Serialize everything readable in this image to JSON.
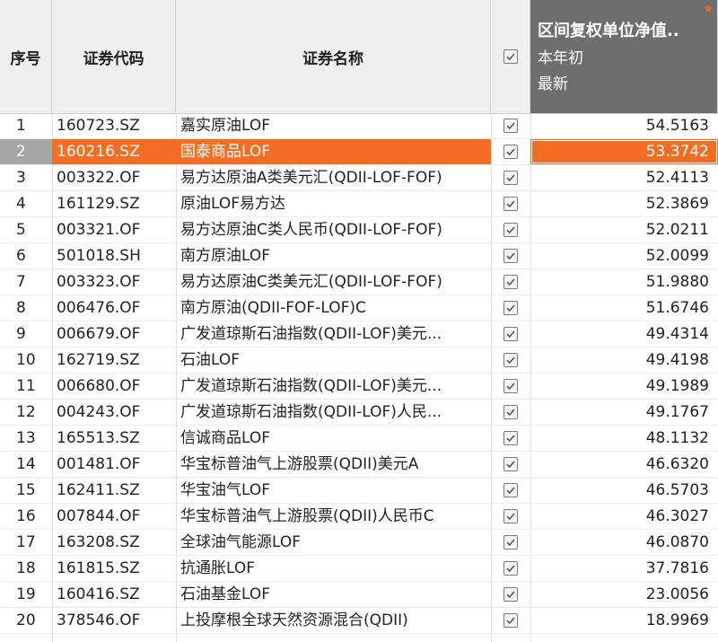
{
  "header": {
    "seq": "序号",
    "code": "证券代码",
    "name": "证券名称",
    "value_title": "区间复权单位净值..",
    "value_sub1": "本年初",
    "value_sub2": "最新",
    "star": "★",
    "check_icon": "checkbox-checked-icon"
  },
  "colors": {
    "selected_row": "#f36d22",
    "header_value_bg": "#6e6e6e",
    "star": "#f36d22"
  },
  "selected_index": 1,
  "rows": [
    {
      "seq": "1",
      "code": "160723.SZ",
      "name": "嘉实原油LOF",
      "value": "54.5163"
    },
    {
      "seq": "2",
      "code": "160216.SZ",
      "name": "国泰商品LOF",
      "value": "53.3742"
    },
    {
      "seq": "3",
      "code": "003322.OF",
      "name": "易方达原油A类美元汇(QDII-LOF-FOF)",
      "value": "52.4113"
    },
    {
      "seq": "4",
      "code": "161129.SZ",
      "name": "原油LOF易方达",
      "value": "52.3869"
    },
    {
      "seq": "5",
      "code": "003321.OF",
      "name": "易方达原油C类人民币(QDII-LOF-FOF)",
      "value": "52.0211"
    },
    {
      "seq": "6",
      "code": "501018.SH",
      "name": "南方原油LOF",
      "value": "52.0099"
    },
    {
      "seq": "7",
      "code": "003323.OF",
      "name": "易方达原油C类美元汇(QDII-LOF-FOF)",
      "value": "51.9880"
    },
    {
      "seq": "8",
      "code": "006476.OF",
      "name": "南方原油(QDII-FOF-LOF)C",
      "value": "51.6746"
    },
    {
      "seq": "9",
      "code": "006679.OF",
      "name": "广发道琼斯石油指数(QDII-LOF)美元...",
      "value": "49.4314"
    },
    {
      "seq": "10",
      "code": "162719.SZ",
      "name": "石油LOF",
      "value": "49.4198"
    },
    {
      "seq": "11",
      "code": "006680.OF",
      "name": "广发道琼斯石油指数(QDII-LOF)美元...",
      "value": "49.1989"
    },
    {
      "seq": "12",
      "code": "004243.OF",
      "name": "广发道琼斯石油指数(QDII-LOF)人民...",
      "value": "49.1767"
    },
    {
      "seq": "13",
      "code": "165513.SZ",
      "name": "信诚商品LOF",
      "value": "48.1132"
    },
    {
      "seq": "14",
      "code": "001481.OF",
      "name": "华宝标普油气上游股票(QDII)美元A",
      "value": "46.6320"
    },
    {
      "seq": "15",
      "code": "162411.SZ",
      "name": "华宝油气LOF",
      "value": "46.5703"
    },
    {
      "seq": "16",
      "code": "007844.OF",
      "name": "华宝标普油气上游股票(QDII)人民币C",
      "value": "46.3027"
    },
    {
      "seq": "17",
      "code": "163208.SZ",
      "name": "全球油气能源LOF",
      "value": "46.0870"
    },
    {
      "seq": "18",
      "code": "161815.SZ",
      "name": "抗通胀LOF",
      "value": "37.7816"
    },
    {
      "seq": "19",
      "code": "160416.SZ",
      "name": "石油基金LOF",
      "value": "23.0056"
    },
    {
      "seq": "20",
      "code": "378546.OF",
      "name": "上投摩根全球天然资源混合(QDII)",
      "value": "18.9969"
    }
  ]
}
